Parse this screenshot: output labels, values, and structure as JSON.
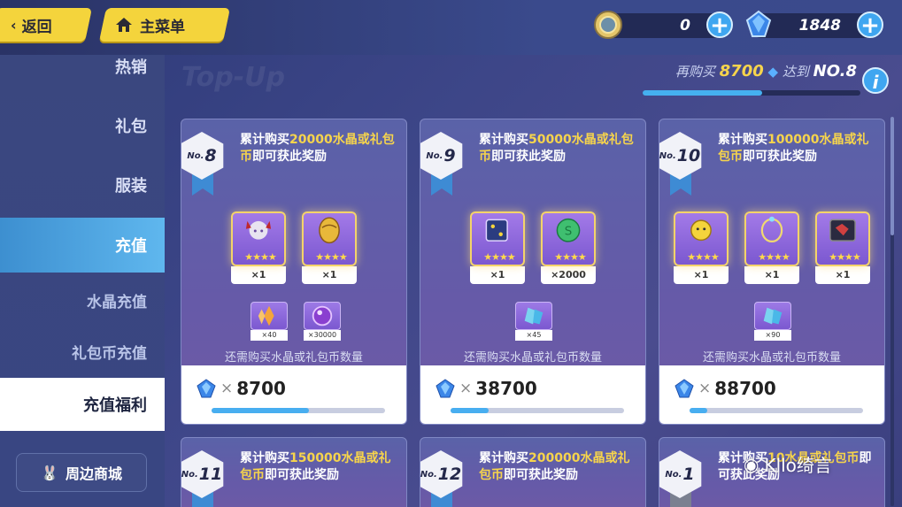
{
  "nav": {
    "back_label": "返回",
    "menu_label": "主菜单"
  },
  "currency": {
    "coin_value": "0",
    "crystal_value": "1848"
  },
  "sidebar": {
    "items": [
      {
        "label": "热销"
      },
      {
        "label": "礼包"
      },
      {
        "label": "服装"
      },
      {
        "label": "充值"
      },
      {
        "label": "水晶充值"
      },
      {
        "label": "礼包币充值"
      },
      {
        "label": "充值福利"
      }
    ],
    "shop_label": "周边商城"
  },
  "watermark_text": "Top-Up",
  "progress": {
    "prefix": "再购买",
    "amount": "8700",
    "mid": "达到",
    "target": "NO.8",
    "fill_fraction": 0.55
  },
  "cards": [
    {
      "no_prefix": "No.",
      "no": "8",
      "title_a": "累计购买",
      "title_hl1": "20000水晶或礼",
      "title_hl2": "包币",
      "title_b": "即可获此奖励",
      "items": [
        {
          "name": "character",
          "count": "×1"
        },
        {
          "name": "golden-egg",
          "count": "×1"
        }
      ],
      "minis": [
        {
          "name": "orange-crystal",
          "count": "×40"
        },
        {
          "name": "purple-orb",
          "count": "×30000"
        }
      ],
      "need": "还需购买水晶或礼包币数量",
      "x": "×",
      "amount": "8700",
      "fill_fraction": 0.56
    },
    {
      "no_prefix": "No.",
      "no": "9",
      "title_a": "累计购买",
      "title_hl1": "50000水晶或礼",
      "title_hl2": "包币",
      "title_b": "即可获此奖励",
      "items": [
        {
          "name": "dice-box",
          "count": "×1"
        },
        {
          "name": "green-coin",
          "count": "×2000"
        }
      ],
      "minis": [
        {
          "name": "blue-crystal",
          "count": "×45"
        }
      ],
      "need": "还需购买水晶或礼包币数量",
      "x": "×",
      "amount": "38700",
      "fill_fraction": 0.22
    },
    {
      "no_prefix": "No.",
      "no": "10",
      "title_a": "累计购买",
      "title_hl1": "100000水晶或礼",
      "title_hl2": "包币",
      "title_b": "即可获此奖励",
      "items": [
        {
          "name": "yellow-plush",
          "count": "×1"
        },
        {
          "name": "necklace",
          "count": "×1"
        },
        {
          "name": "dark-box",
          "count": "×1"
        }
      ],
      "minis": [
        {
          "name": "blue-crystal",
          "count": "×90"
        }
      ],
      "need": "还需购买水晶或礼包币数量",
      "x": "×",
      "amount": "88700",
      "fill_fraction": 0.1
    }
  ],
  "next_cards": [
    {
      "no": "11",
      "title_a": "累计购买",
      "title_hl1": "150000水晶或礼",
      "title_hl2": "包币",
      "title_b": "即可获此奖励"
    },
    {
      "no": "12",
      "title_a": "累计购买",
      "title_hl1": "200000水晶或礼",
      "title_hl2": "包币",
      "title_b": "即可获此奖励"
    },
    {
      "no": "1",
      "title_a": "累计购买",
      "title_hl1": "10水晶或礼包币",
      "title_hl2": "",
      "title_b": "即可获此奖励"
    }
  ],
  "overlay_watermark": "Kllo绮言"
}
